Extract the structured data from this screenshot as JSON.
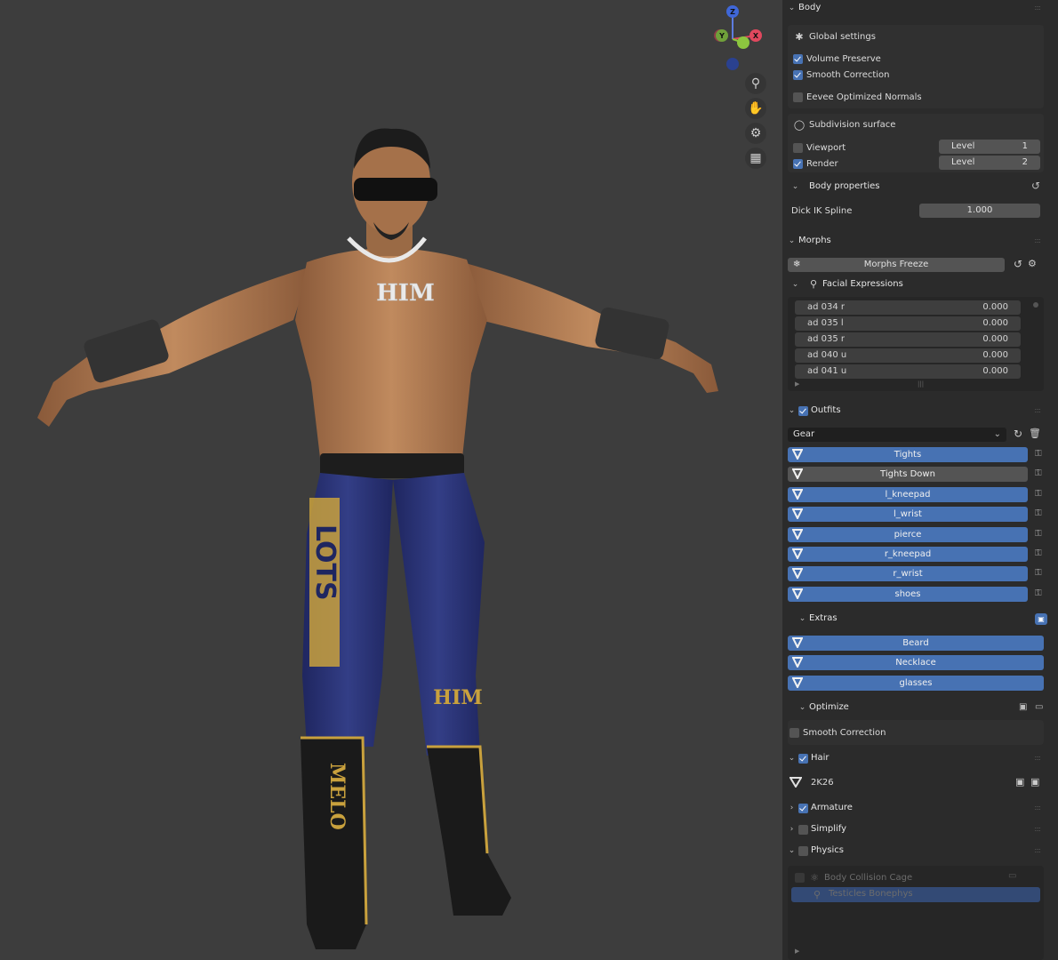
{
  "viewport": {
    "necklace_text": "HIM",
    "pants_text": "LOTS",
    "kneepad_text": "HIM",
    "boot_text": "MELO",
    "gizmo": {
      "z": "Z",
      "y": "Y",
      "x": "X"
    },
    "tools": [
      "zoom-icon",
      "hand-icon",
      "camera-icon",
      "grid-icon"
    ]
  },
  "panel": {
    "body": {
      "header": "Body",
      "global_settings": {
        "title": "Global settings",
        "volume_preserve": {
          "label": "Volume Preserve",
          "checked": true
        },
        "smooth_correction": {
          "label": "Smooth Correction",
          "checked": true
        },
        "eevee_normals": {
          "label": "Eevee Optimized Normals",
          "checked": false
        }
      },
      "subdivision": {
        "title": "Subdivision surface",
        "viewport": {
          "label": "Viewport",
          "checked": false,
          "level_label": "Level",
          "level": "1"
        },
        "render": {
          "label": "Render",
          "checked": true,
          "level_label": "Level",
          "level": "2"
        }
      },
      "body_properties": {
        "title": "Body properties",
        "dick_ik_label": "Dick IK Spline",
        "dick_ik_value": "1.000"
      }
    },
    "morphs": {
      "header": "Morphs",
      "freeze_label": "Morphs Freeze",
      "facial_title": "Facial Expressions",
      "items": [
        {
          "name": "ad 034 r",
          "value": "0.000"
        },
        {
          "name": "ad 035 l",
          "value": "0.000"
        },
        {
          "name": "ad 035 r",
          "value": "0.000"
        },
        {
          "name": "ad 040 u",
          "value": "0.000"
        },
        {
          "name": "ad 041 u",
          "value": "0.000"
        }
      ]
    },
    "outfits": {
      "header": "Outfits",
      "checked": true,
      "dropdown_value": "Gear",
      "items": [
        {
          "label": "Tights",
          "on": true
        },
        {
          "label": "Tights Down",
          "on": false
        },
        {
          "label": "l_kneepad",
          "on": true
        },
        {
          "label": "l_wrist",
          "on": true
        },
        {
          "label": "pierce",
          "on": true
        },
        {
          "label": "r_kneepad",
          "on": true
        },
        {
          "label": "r_wrist",
          "on": true
        },
        {
          "label": "shoes",
          "on": true
        }
      ]
    },
    "extras": {
      "header": "Extras",
      "items": [
        {
          "label": "Beard",
          "on": true
        },
        {
          "label": "Necklace",
          "on": true
        },
        {
          "label": "glasses",
          "on": true
        }
      ]
    },
    "optimize": {
      "header": "Optimize",
      "smooth_correction": {
        "label": "Smooth Correction",
        "checked": false
      }
    },
    "hair": {
      "header": "Hair",
      "checked": true,
      "item": "2K26"
    },
    "armature": {
      "header": "Armature",
      "checked": true
    },
    "simplify": {
      "header": "Simplify",
      "checked": false
    },
    "physics": {
      "header": "Physics",
      "checked": false,
      "items": [
        "Body Collision Cage",
        "Testicles Bonephys"
      ]
    }
  },
  "colors": {
    "accent": "#4772b3",
    "panel_bg": "#2b2b2b",
    "viewport_bg": "#3d3d3d",
    "skin": "#b07a52",
    "tights": "#2a3270",
    "gold": "#c9a13d"
  }
}
